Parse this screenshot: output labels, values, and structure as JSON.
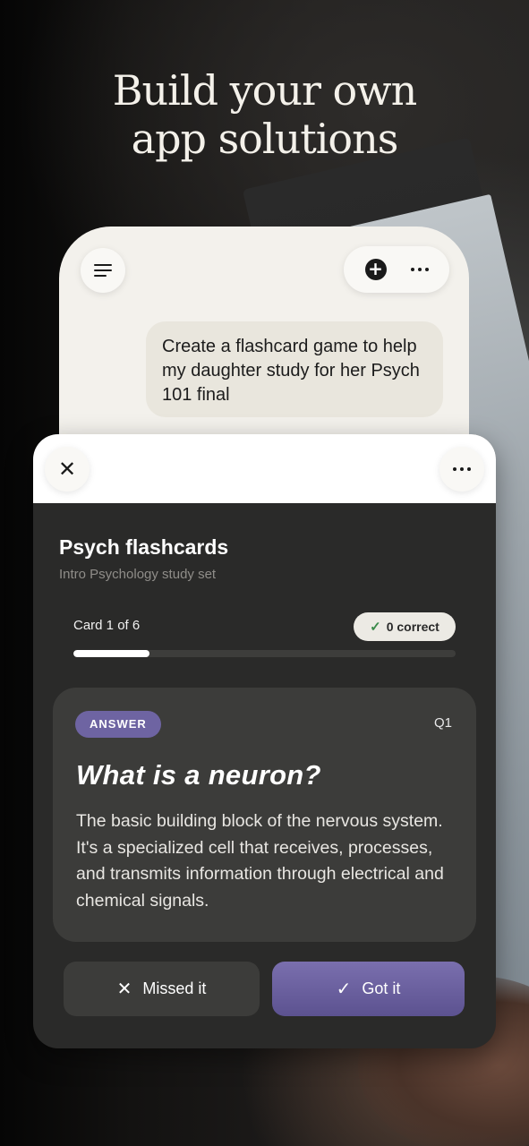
{
  "headline": {
    "line1": "Build your own",
    "line2": "app solutions"
  },
  "phone": {
    "chat_prompt": "Create a flashcard game to help my daughter study for her Psych 101 final",
    "icons": [
      "menu-icon",
      "new-chat-icon",
      "more-icon"
    ]
  },
  "artifact": {
    "title": "Psych flashcards",
    "subtitle": "Intro Psychology study set",
    "progress_label": "Card 1 of 6",
    "progress": 0.2,
    "correct_label": "0 correct",
    "card": {
      "badge": "ANSWER",
      "number": "Q1",
      "question": "What is a neuron?",
      "answer": "The basic building block of the nervous system. It's a specialized cell that receives, processes, and transmits information through electrical and chemical signals."
    },
    "buttons": {
      "missed": "Missed it",
      "got": "Got it"
    }
  },
  "colors": {
    "accent": "#6e64a2",
    "card_bg": "#3c3c3a",
    "panel_bg": "#2a2a29",
    "phone_bg": "#f3f1ec"
  }
}
